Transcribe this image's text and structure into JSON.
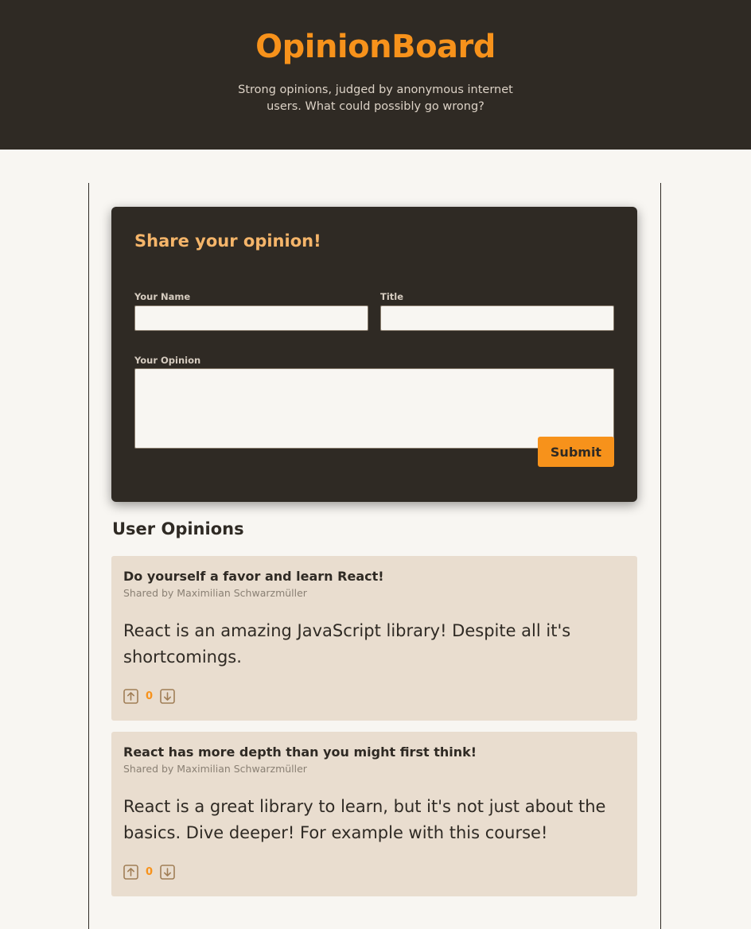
{
  "header": {
    "title": "OpinionBoard",
    "subtitle": "Strong opinions, judged by anonymous internet users. What could possibly go wrong?"
  },
  "form": {
    "heading": "Share your opinion!",
    "name_label": "Your Name",
    "name_value": "",
    "title_label": "Title",
    "title_value": "",
    "opinion_label": "Your Opinion",
    "opinion_value": "",
    "submit_label": "Submit"
  },
  "opinions": {
    "heading": "User Opinions",
    "items": [
      {
        "title": "Do yourself a favor and learn React!",
        "author": "Shared by Maximilian Schwarzmüller",
        "body": "React is an amazing JavaScript library! Despite all it's shortcomings.",
        "votes": "0"
      },
      {
        "title": "React has more depth than you might first think!",
        "author": "Shared by Maximilian Schwarzmüller",
        "body": "React is a great library to learn, but it's not just about the basics. Dive deeper! For example with this course!",
        "votes": "0"
      }
    ]
  },
  "icons": {
    "upvote": "arrow-up-square-icon",
    "downvote": "arrow-down-square-icon"
  },
  "colors": {
    "brand": "#f7921b",
    "header_bg": "#2f2a24",
    "page_bg": "#f8f6f2",
    "card_bg": "#e9ddcf",
    "form_heading": "#f5b56a"
  }
}
